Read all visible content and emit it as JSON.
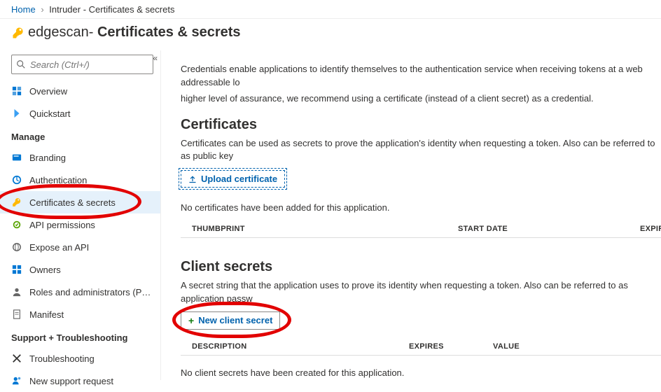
{
  "breadcrumb": {
    "home": "Home",
    "current": "Intruder - Certificates & secrets"
  },
  "title": {
    "app": "edgescan",
    "section": "Certificates & secrets"
  },
  "search": {
    "placeholder": "Search (Ctrl+/)"
  },
  "sidebar": {
    "items_top": [
      {
        "label": "Overview"
      },
      {
        "label": "Quickstart"
      }
    ],
    "manage_label": "Manage",
    "items_manage": [
      {
        "label": "Branding"
      },
      {
        "label": "Authentication"
      },
      {
        "label": "Certificates & secrets",
        "selected": true
      },
      {
        "label": "API permissions"
      },
      {
        "label": "Expose an API"
      },
      {
        "label": "Owners"
      },
      {
        "label": "Roles and administrators (Previ..."
      },
      {
        "label": "Manifest"
      }
    ],
    "support_label": "Support + Troubleshooting",
    "items_support": [
      {
        "label": "Troubleshooting"
      },
      {
        "label": "New support request"
      }
    ]
  },
  "main": {
    "intro1": "Credentials enable applications to identify themselves to the authentication service when receiving tokens at a web addressable lo",
    "intro2": "higher level of assurance, we recommend using a certificate (instead of a client secret) as a credential.",
    "cert_heading": "Certificates",
    "cert_desc": "Certificates can be used as secrets to prove the application's identity when requesting a token. Also can be referred to as public key",
    "upload_btn": "Upload certificate",
    "cert_empty": "No certificates have been added for this application.",
    "cert_cols": {
      "thumb": "THUMBPRINT",
      "start": "START DATE",
      "exp": "EXPIRES"
    },
    "secret_heading": "Client secrets",
    "secret_desc": "A secret string that the application uses to prove its identity when requesting a token. Also can be referred to as application passw",
    "new_secret_btn": "New client secret",
    "secret_cols": {
      "desc": "DESCRIPTION",
      "exp": "EXPIRES",
      "val": "VALUE"
    },
    "secret_empty": "No client secrets have been created for this application."
  }
}
